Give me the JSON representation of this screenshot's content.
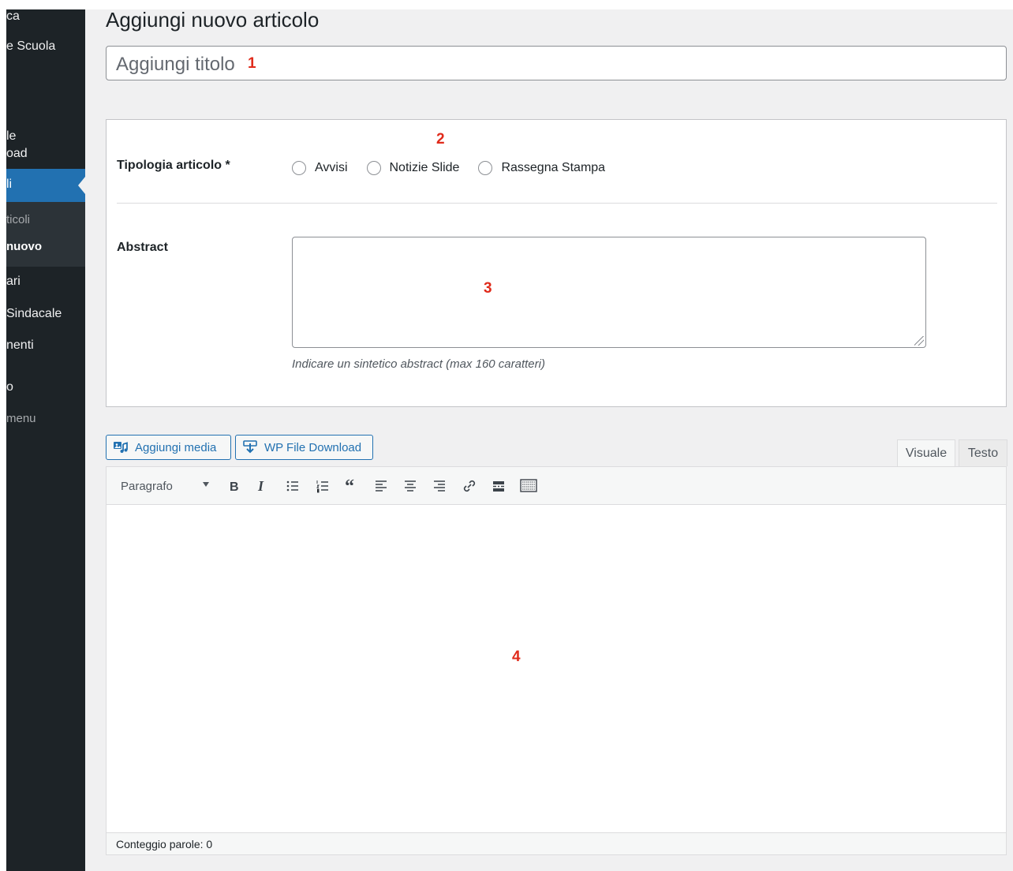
{
  "sidebar": {
    "items": [
      {
        "label": "ca"
      },
      {
        "label": "e Scuola"
      },
      {
        "label": "le"
      },
      {
        "label": "oad"
      },
      {
        "label": "li"
      },
      {
        "label": "ticoli"
      },
      {
        "label": "nuovo"
      },
      {
        "label": "ari"
      },
      {
        "label": "Sindacale"
      },
      {
        "label": "nenti"
      },
      {
        "label": "o"
      },
      {
        "label": "menu"
      }
    ]
  },
  "page": {
    "title": "Aggiungi nuovo articolo",
    "title_placeholder": "Aggiungi titolo"
  },
  "markers": [
    "1",
    "2",
    "3",
    "4"
  ],
  "meta": {
    "tipologia_label": "Tipologia articolo *",
    "options": [
      "Avvisi",
      "Notizie Slide",
      "Rassegna Stampa"
    ],
    "abstract_label": "Abstract",
    "abstract_help": "Indicare un sintetico abstract (max 160 caratteri)"
  },
  "media_buttons": {
    "add_media": "Aggiungi media",
    "wp_file_download": "WP File Download"
  },
  "editor_tabs": {
    "visual": "Visuale",
    "text": "Testo"
  },
  "toolbar": {
    "format_value": "Paragrafo"
  },
  "status": {
    "word_count": "Conteggio parole: 0"
  },
  "colors": {
    "accent": "#2271b1",
    "sidebar_bg": "#1d2327",
    "marker": "#e02b1b"
  }
}
